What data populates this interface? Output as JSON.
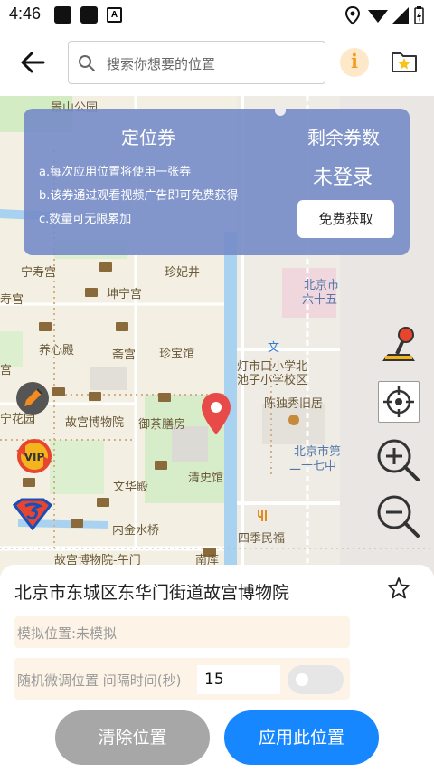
{
  "status_bar": {
    "time": "4:46",
    "notification_letter": "A"
  },
  "header": {
    "search_placeholder": "搜索你想要的位置",
    "info_label": "i"
  },
  "map": {
    "labels": [
      {
        "text": "景山公园",
        "color": "brown"
      },
      {
        "text": "宁寿宫",
        "color": "brown"
      },
      {
        "text": "珍妃井",
        "color": "brown"
      },
      {
        "text": "坤宁宫",
        "color": "brown"
      },
      {
        "text": "寿宫",
        "color": "brown"
      },
      {
        "text": "养心殿",
        "color": "brown"
      },
      {
        "text": "斋宫",
        "color": "brown"
      },
      {
        "text": "珍宝馆",
        "color": "brown"
      },
      {
        "text": "宫",
        "color": "brown"
      },
      {
        "text": "故宫博物院",
        "color": "brown"
      },
      {
        "text": "御茶膳房",
        "color": "brown"
      },
      {
        "text": "宁花园",
        "color": "brown"
      },
      {
        "text": "清史馆",
        "color": "brown"
      },
      {
        "text": "文华殿",
        "color": "brown"
      },
      {
        "text": "内金水桥",
        "color": "brown"
      },
      {
        "text": "故宫博物院-午门",
        "color": "brown"
      },
      {
        "text": "南库",
        "color": "brown"
      },
      {
        "text": "四季民福",
        "color": "brown"
      },
      {
        "text": "北京市",
        "color": "blue"
      },
      {
        "text": "六十五",
        "color": "blue"
      },
      {
        "text": "灯市口小学北",
        "color": "brown"
      },
      {
        "text": "池子小学校区",
        "color": "brown"
      },
      {
        "text": "陈独秀旧居",
        "color": "brown"
      },
      {
        "text": "北京市第",
        "color": "blue"
      },
      {
        "text": "二十七中",
        "color": "blue"
      },
      {
        "text": "文",
        "color": "blue"
      }
    ]
  },
  "coupon": {
    "title": "定位券",
    "lines": [
      "a.每次应用位置将使用一张券",
      "b.该券通过观看视频广告即可免费获得",
      "c.数量可无限累加"
    ],
    "remaining_title": "剩余券数",
    "login_status": "未登录",
    "free_button": "免费获取"
  },
  "bottom": {
    "address": "北京市东城区东华门街道故宫博物院",
    "simulate_status": "模拟位置:未模拟",
    "random_label": "随机微调位置 间隔时间(秒)",
    "interval_value": "15",
    "random_enabled": false,
    "clear_button": "清除位置",
    "apply_button": "应用此位置"
  },
  "colors": {
    "accent": "#1787ff",
    "panel": "#768cc8",
    "pin": "#e84a4a",
    "disabled": "#a7a7a7"
  }
}
